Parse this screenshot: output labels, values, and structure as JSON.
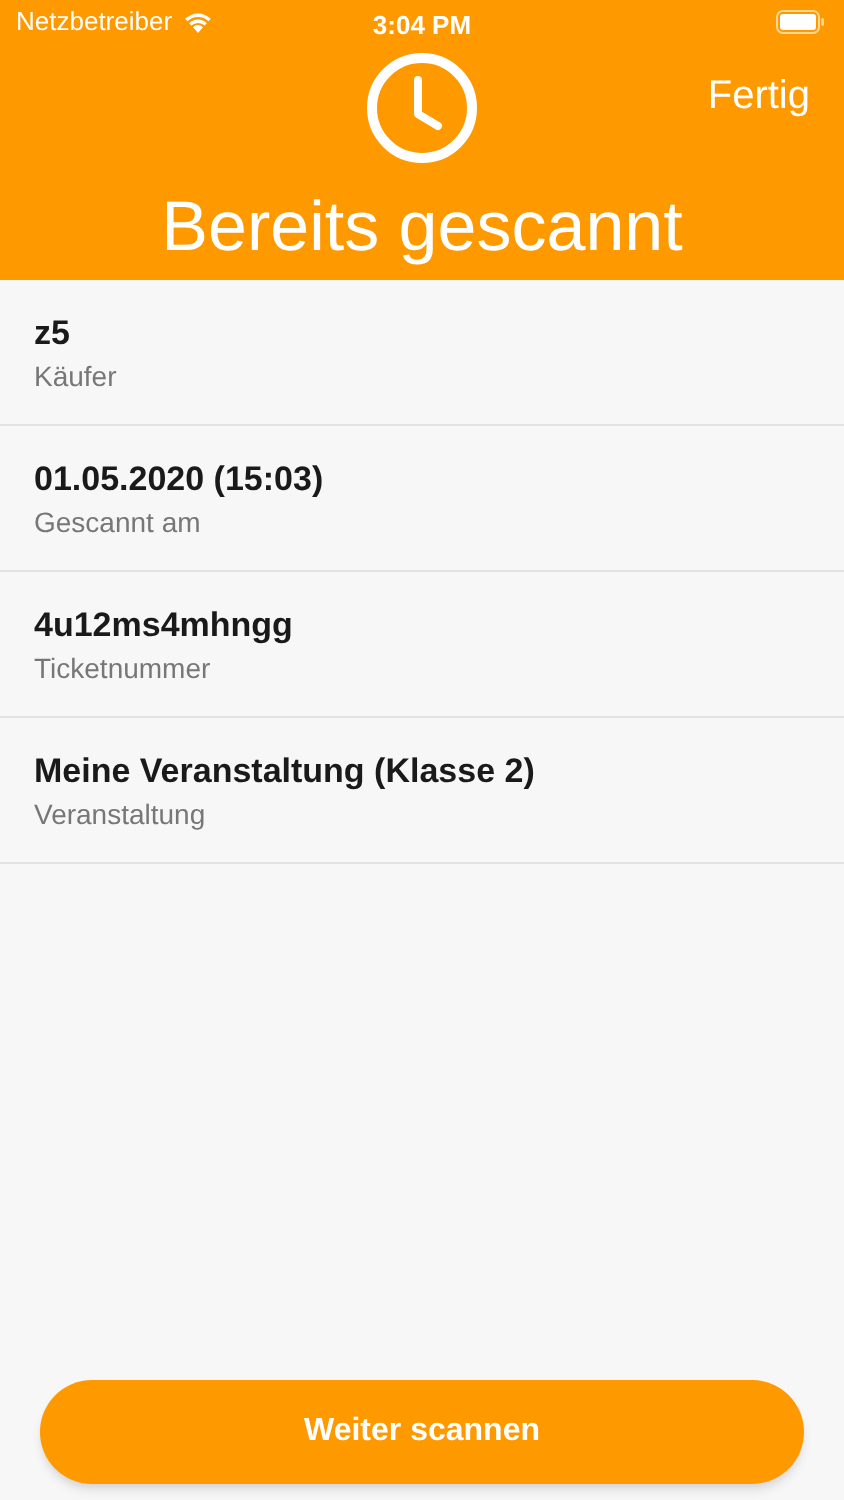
{
  "status_bar": {
    "carrier": "Netzbetreiber",
    "time": "3:04 PM"
  },
  "header": {
    "done": "Fertig",
    "title": "Bereits gescannt"
  },
  "details": [
    {
      "value": "z5",
      "label": "Käufer"
    },
    {
      "value": "01.05.2020 (15:03)",
      "label": "Gescannt am"
    },
    {
      "value": "4u12ms4mhngg",
      "label": "Ticketnummer"
    },
    {
      "value": "Meine Veranstaltung (Klasse 2)",
      "label": "Veranstaltung"
    }
  ],
  "button": "Weiter scannen"
}
